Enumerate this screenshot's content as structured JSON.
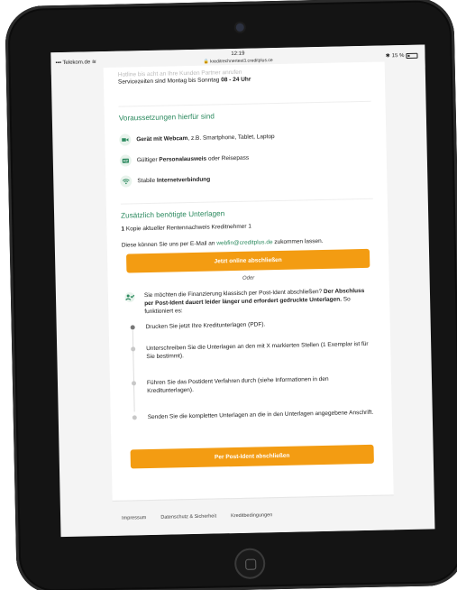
{
  "statusbar": {
    "carrier": "Telekom.de",
    "time": "12:19",
    "url": "kreditrechnertest3.creditplus.ce",
    "battery": "15 %"
  },
  "service": {
    "blurred_line": "Hotline bis acht an Ihre Kunden Partner anrufen",
    "hours_prefix": "Servicezeiten sind Montag bis Sonntag ",
    "hours_value": "08 - 24 Uhr"
  },
  "requirements": {
    "title": "Voraussetzungen hierfür sind",
    "items": [
      {
        "icon": "webcam-icon",
        "bold": "Gerät mit Webcam",
        "rest": ", z.B. Smartphone, Tablet, Laptop",
        "color": "#2c8a5f"
      },
      {
        "icon": "id-card-icon",
        "pre": "Gültiger ",
        "bold": "Personalausweis",
        "rest": " oder Reisepass",
        "color": "#2c8a5f"
      },
      {
        "icon": "wifi-icon",
        "pre": "Stabile ",
        "bold": "Internetverbindung",
        "rest": "",
        "color": "#2c8a5f"
      }
    ]
  },
  "documents": {
    "title": "Zusätzlich benötigte Unterlagen",
    "line_bold": "1",
    "line_rest": " Kopie aktueller Rentennachweis Kreditnehmer 1",
    "email_prefix": "Diese können Sie uns per E-Mail an ",
    "email": "webfin@creditplus.de",
    "email_suffix": " zukommen lassen."
  },
  "buttons": {
    "online": "Jetzt online abschließen",
    "oder": "Oder",
    "postident": "Per Post-Ident abschließen"
  },
  "postident": {
    "intro_pre": "Sie möchten die Finanzierung klassisch per Post-Ident abschließen? ",
    "intro_bold": "Der Abschluss per Post-Ident dauert leider länger und erfordert gedruckte Unterlagen.",
    "intro_post": " So funktioniert es:",
    "steps": [
      "Drucken Sie jetzt Ihre Kreditunterlagen (PDF).",
      "Unterschreiben Sie die Unterlagen an den mit X markierten Stellen (1 Exemplar ist für Sie bestimmt).",
      "Führen Sie das Postident Verfahren durch (siehe Informationen in den Kreditunterlagen).",
      "Senden Sie die kompletten Unterlagen an die in den Unterlagen angegebene Anschrift."
    ]
  },
  "footer": {
    "links": [
      "Impressum",
      "Datenschutz & Sicherheit",
      "Kreditbedingungen"
    ]
  },
  "colors": {
    "accent_green": "#2c8a5f",
    "button_orange": "#f39c12"
  }
}
